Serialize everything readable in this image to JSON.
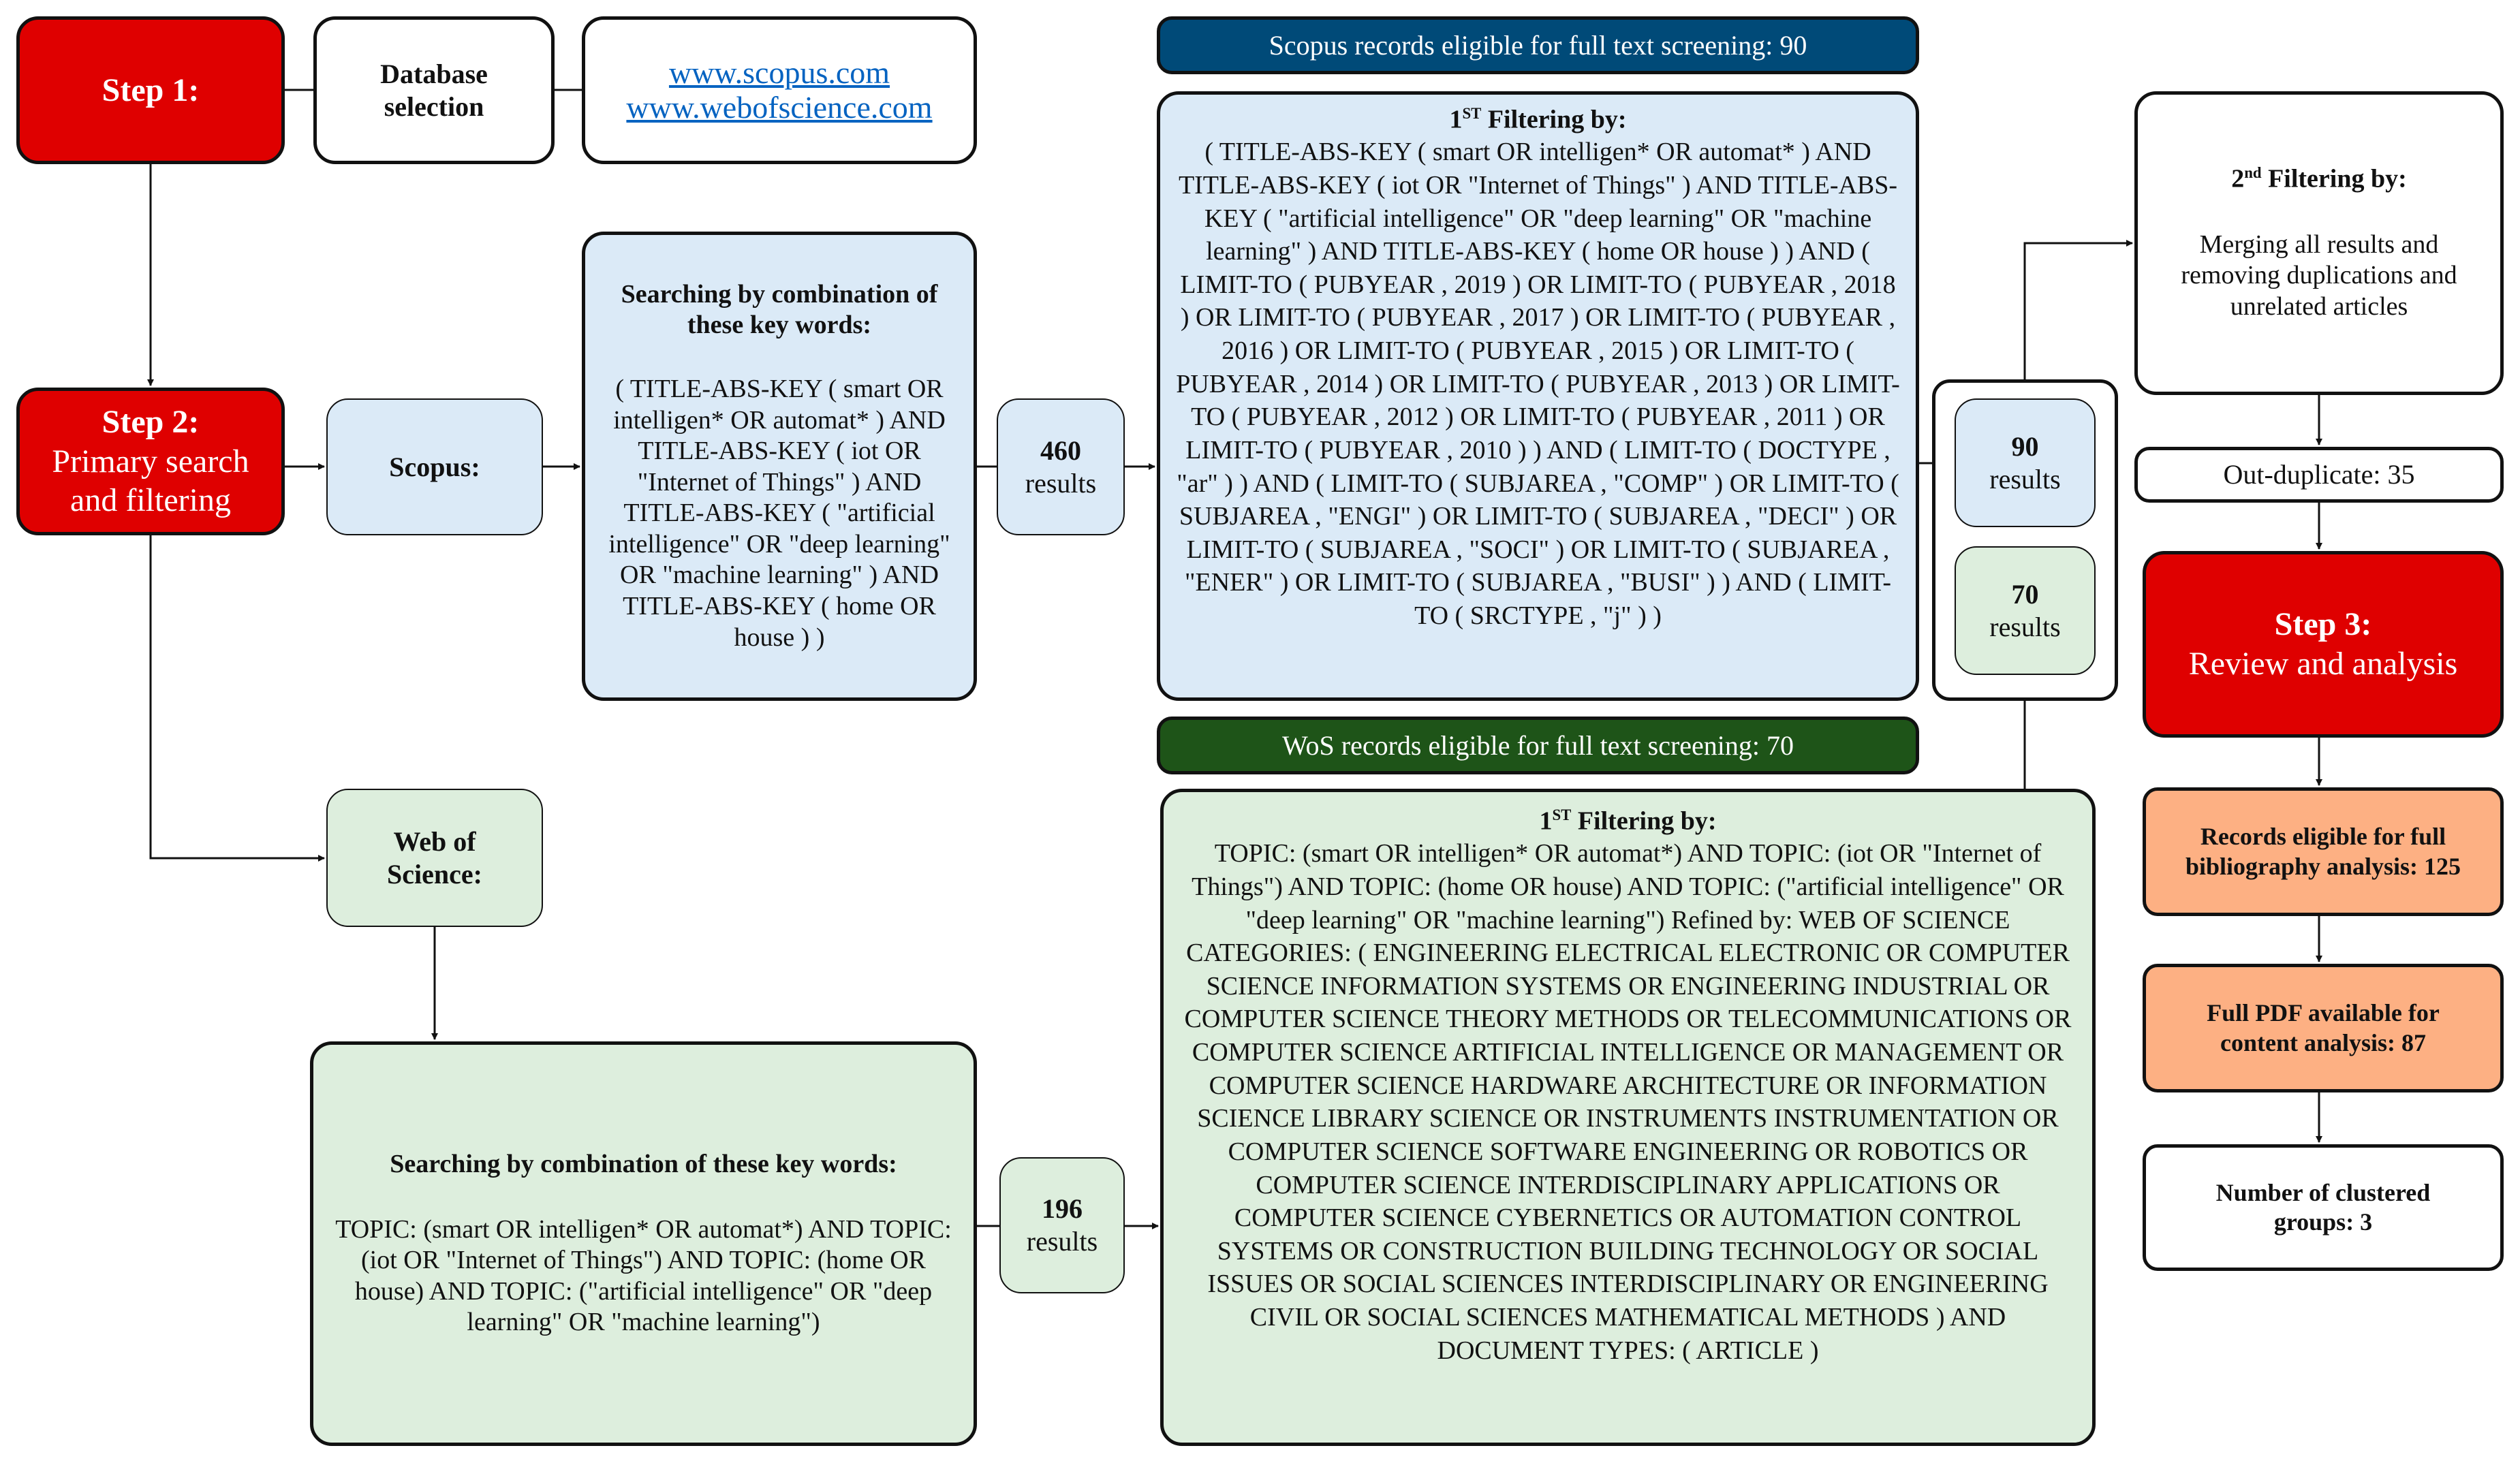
{
  "step1": {
    "title": "Step 1:"
  },
  "database_selection": {
    "label": "Database selection"
  },
  "databases": {
    "links": [
      "www.scopus.com",
      "www.webofscience.com"
    ]
  },
  "step2": {
    "title": "Step 2:",
    "subtitle": "Primary search and filtering"
  },
  "scopus": {
    "label": "Scopus:",
    "search_heading": "Searching by combination of these key words:",
    "search_query": "( TITLE-ABS-KEY ( smart OR intelligen* OR automat* ) AND TITLE-ABS-KEY ( iot OR \"Internet of Things\" ) AND TITLE-ABS-KEY ( \"artificial intelligence\" OR \"deep learning\" OR \"machine learning\" ) AND TITLE-ABS-KEY ( home OR house ) )",
    "results_count": "460",
    "results_label": "results",
    "eligible_header": "Scopus records eligible for full text screening: 90",
    "filter_heading_prefix": "1",
    "filter_heading_sup": "ST",
    "filter_heading_suffix": " Filtering by:",
    "filter_query": "( TITLE-ABS-KEY ( smart OR intelligen* OR automat* ) AND TITLE-ABS-KEY ( iot OR \"Internet of Things\" ) AND TITLE-ABS-KEY ( \"artificial intelligence\" OR \"deep learning\" OR \"machine learning\" ) AND TITLE-ABS-KEY ( home OR house ) ) AND ( LIMIT-TO ( PUBYEAR , 2019 ) OR LIMIT-TO ( PUBYEAR , 2018 ) OR LIMIT-TO ( PUBYEAR , 2017 ) OR LIMIT-TO ( PUBYEAR , 2016 ) OR LIMIT-TO ( PUBYEAR , 2015 ) OR LIMIT-TO ( PUBYEAR , 2014 ) OR LIMIT-TO ( PUBYEAR , 2013 ) OR LIMIT-TO ( PUBYEAR , 2012 ) OR LIMIT-TO ( PUBYEAR , 2011 ) OR LIMIT-TO ( PUBYEAR , 2010 ) ) AND ( LIMIT-TO ( DOCTYPE , \"ar\" ) ) AND ( LIMIT-TO ( SUBJAREA , \"COMP\" ) OR LIMIT-TO ( SUBJAREA , \"ENGI\" ) OR LIMIT-TO ( SUBJAREA , \"DECI\" ) OR LIMIT-TO ( SUBJAREA , \"SOCI\" ) OR LIMIT-TO ( SUBJAREA , \"ENER\" ) OR LIMIT-TO ( SUBJAREA , \"BUSI\" ) ) AND ( LIMIT-TO ( SRCTYPE , \"j\" ) )",
    "filtered_count": "90",
    "filtered_label": "results"
  },
  "wos": {
    "label": "Web of Science:",
    "search_heading": "Searching by combination of these key words:",
    "search_query": "TOPIC: (smart OR intelligen* OR automat*) AND TOPIC: (iot OR \"Internet of Things\") AND TOPIC: (home OR house) AND TOPIC: (\"artificial intelligence\" OR \"deep learning\" OR \"machine learning\")",
    "results_count": "196",
    "results_label": "results",
    "eligible_header": "WoS records eligible for full text screening: 70",
    "filter_heading_prefix": "1",
    "filter_heading_sup": "ST",
    "filter_heading_suffix": " Filtering by:",
    "filter_query": "TOPIC: (smart OR intelligen* OR automat*) AND TOPIC: (iot OR \"Internet of Things\") AND TOPIC: (home OR house) AND TOPIC: (\"artificial intelligence\" OR \"deep learning\" OR \"machine learning\") Refined by: WEB OF SCIENCE CATEGORIES: ( ENGINEERING ELECTRICAL ELECTRONIC OR COMPUTER SCIENCE INFORMATION SYSTEMS OR ENGINEERING INDUSTRIAL OR COMPUTER SCIENCE THEORY METHODS OR TELECOMMUNICATIONS OR COMPUTER SCIENCE ARTIFICIAL INTELLIGENCE OR MANAGEMENT OR COMPUTER SCIENCE HARDWARE ARCHITECTURE OR INFORMATION SCIENCE LIBRARY SCIENCE OR INSTRUMENTS INSTRUMENTATION OR COMPUTER SCIENCE SOFTWARE ENGINEERING OR ROBOTICS OR COMPUTER SCIENCE INTERDISCIPLINARY APPLICATIONS OR COMPUTER SCIENCE CYBERNETICS OR AUTOMATION CONTROL SYSTEMS OR CONSTRUCTION BUILDING TECHNOLOGY OR SOCIAL ISSUES OR SOCIAL SCIENCES INTERDISCIPLINARY OR ENGINEERING CIVIL OR SOCIAL SCIENCES MATHEMATICAL METHODS ) AND DOCUMENT TYPES: ( ARTICLE )",
    "filtered_count": "70",
    "filtered_label": "results"
  },
  "second_filter": {
    "heading_prefix": "2",
    "heading_sup": "nd",
    "heading_suffix": " Filtering by:",
    "description": "Merging all results and removing duplications and unrelated articles"
  },
  "out_duplicate": {
    "label": "Out-duplicate: 35"
  },
  "step3": {
    "title": "Step 3:",
    "subtitle": "Review and analysis"
  },
  "bibliography": {
    "label": "Records eligible for full bibliography analysis: 125"
  },
  "full_pdf": {
    "label": "Full PDF available for content analysis: 87"
  },
  "clusters": {
    "label": "Number of clustered groups: 3"
  },
  "colors": {
    "step_red": "#df0000",
    "scopus_blue": "#dbeaf7",
    "wos_green": "#ddeedd",
    "scopus_header": "#004a78",
    "wos_header": "#1e5418",
    "orange": "#fdb083",
    "link": "#0563c1"
  }
}
